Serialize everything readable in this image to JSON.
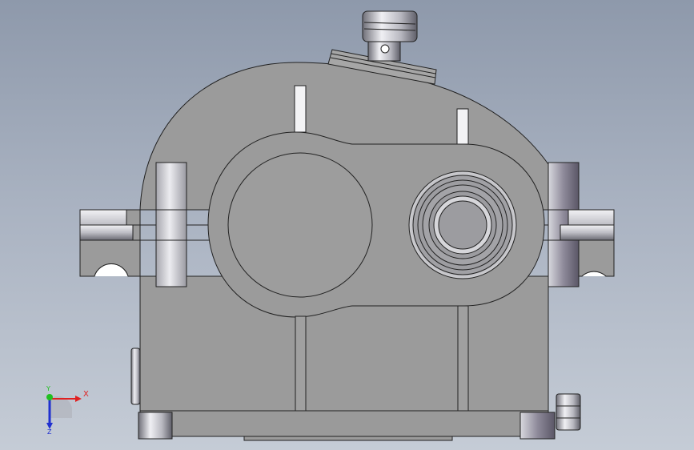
{
  "viewport": {
    "background_top": "#8e99ab",
    "background_bottom": "#c5ccd6"
  },
  "model": {
    "body_color": "#9b9b9b",
    "edge_color": "#222222",
    "highlight_color": "#e9e9ee",
    "shadow_color": "#6d6d76"
  },
  "triad": {
    "x_label": "X",
    "y_label": "Y",
    "z_label": "Z",
    "x_color": "#e02020",
    "y_color": "#20c020",
    "z_color": "#2030d0"
  }
}
